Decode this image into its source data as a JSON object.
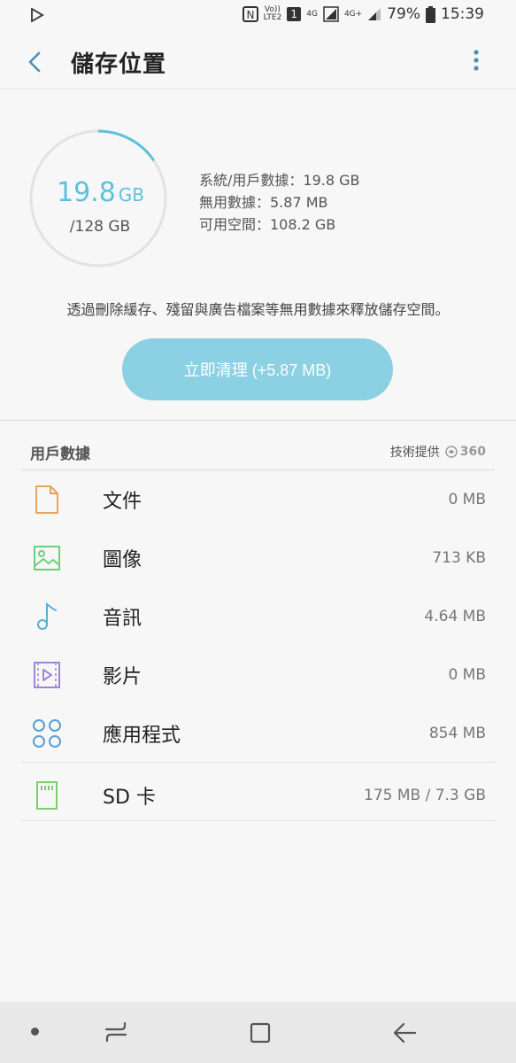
{
  "status_bar": {
    "battery_percent": "79%",
    "time": "15:39",
    "volte_label_top": "Vo))",
    "volte_label_bottom": "LTE2",
    "sim_label": "1",
    "net_4g": "4G",
    "net_4gplus": "4G+",
    "icons": [
      "play-store-icon",
      "nfc-icon",
      "volte-icon",
      "signal-icon",
      "battery-icon"
    ]
  },
  "header": {
    "title": "儲存位置"
  },
  "summary": {
    "used_value": "19.8",
    "used_unit": "GB",
    "total": "/128 GB",
    "used_fraction": 0.155,
    "stats": [
      "系統/用戶數據：19.8 GB",
      "無用數據：5.87 MB",
      "可用空間：108.2 GB"
    ],
    "tip": "透過刪除緩存、殘留與廣告檔案等無用數據來釋放儲存空間。",
    "clean_button": "立即清理 (+5.87 MB)"
  },
  "user_data": {
    "heading": "用戶數據",
    "provider_label": "技術提供",
    "provider_logo": "360",
    "items": [
      {
        "label": "文件",
        "value": "0 MB",
        "icon": "document-icon",
        "color": "#e8a55a"
      },
      {
        "label": "圖像",
        "value": "713 KB",
        "icon": "image-icon",
        "color": "#6ccf7a"
      },
      {
        "label": "音訊",
        "value": "4.64 MB",
        "icon": "music-note-icon",
        "color": "#5aaed6"
      },
      {
        "label": "影片",
        "value": "0 MB",
        "icon": "video-icon",
        "color": "#9b87d6"
      },
      {
        "label": "應用程式",
        "value": "854 MB",
        "icon": "apps-icon",
        "color": "#5a9fd6"
      },
      {
        "label": "SD 卡",
        "value": "175 MB / 7.3 GB",
        "icon": "sd-card-icon",
        "color": "#7ccf6a"
      }
    ]
  },
  "colors": {
    "accent": "#5cc1de",
    "button": "#8cd0e3"
  }
}
